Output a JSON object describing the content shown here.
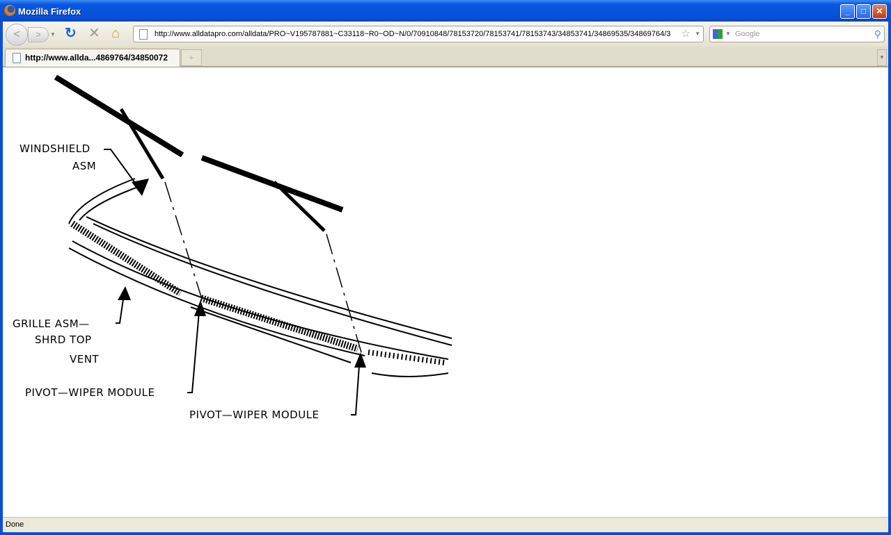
{
  "window": {
    "title": "Mozilla Firefox",
    "minimize": "_",
    "maximize": "□",
    "close": "✕"
  },
  "toolbar": {
    "url": "http://www.alldatapro.com/alldata/PRO~V195787881~C33118~R0~OD~N/0/70910848/78153720/78153741/78153743/34853741/34869535/34869764/3",
    "search_placeholder": "Google"
  },
  "tabs": [
    {
      "label": "http://www.allda...4869764/34850072"
    }
  ],
  "new_tab": "+",
  "diagram": {
    "labels": {
      "windshield_1": "WINDSHIELD",
      "windshield_2": "ASM",
      "grille_1": "GRILLE ASM—",
      "grille_2": "SHRD TOP",
      "grille_3": "VENT",
      "pivot_left": "PIVOT—WIPER MODULE",
      "pivot_right": "PIVOT—WIPER MODULE"
    }
  },
  "status": {
    "text": "Done"
  }
}
